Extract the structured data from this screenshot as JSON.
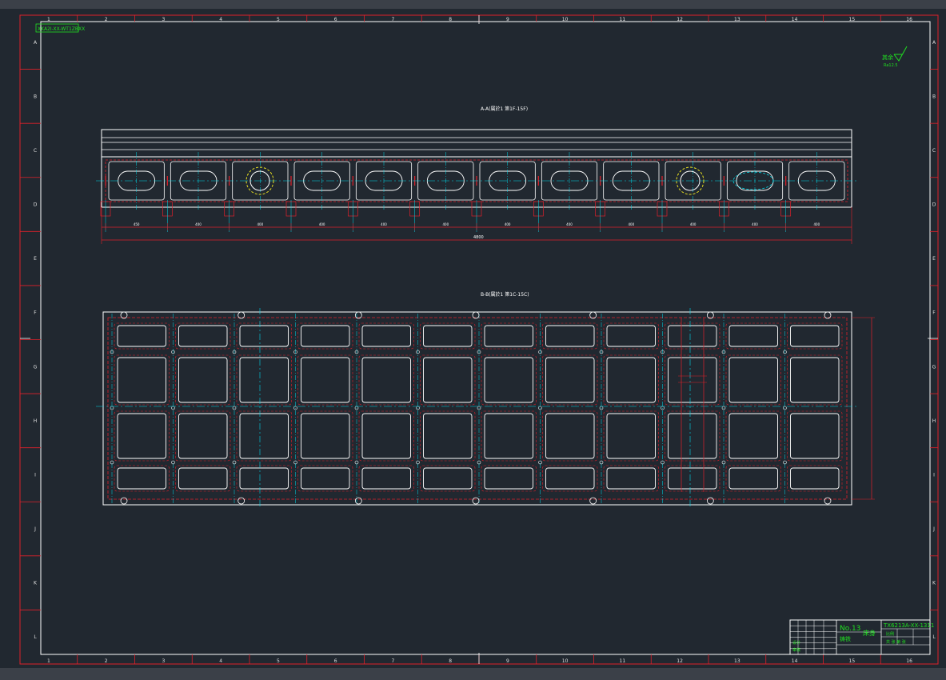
{
  "drawing": {
    "drawing_code_stamp": "XKA2I-XX-WT1ZBXX",
    "section_a_title": "A-A(属於1 第1F-15F)",
    "section_b_title": "B-B(属於1 第1C-15C)",
    "roughness_note_label": "其余",
    "roughness_note_sub": "Ra12.5",
    "col_numbers": [
      "1",
      "2",
      "3",
      "4",
      "5",
      "6",
      "7",
      "8",
      "9",
      "10",
      "11",
      "12",
      "13",
      "14",
      "15",
      "16"
    ],
    "row_letters": [
      "A",
      "B",
      "C",
      "D",
      "E",
      "F",
      "G",
      "H",
      "I",
      "J",
      "K",
      "L"
    ],
    "overall_length_dim": "4800",
    "segment_dims": [
      "450",
      "400",
      "400",
      "400",
      "400",
      "400",
      "400",
      "400",
      "400",
      "400",
      "400",
      "400"
    ]
  },
  "title_block": {
    "number": "No.13",
    "part_name": "床身",
    "material": "铸铁",
    "drawing_no": "TX6213A-XX-1311",
    "scale_label": "比例",
    "sheet_label": "共 张 第 张",
    "designer_label": "设计",
    "checker_label": "审核"
  },
  "colors": {
    "background": "#212830",
    "frame_red": "#e0202a",
    "outline_white": "#ffffff",
    "centerline_cyan": "#00d8e8",
    "text_green": "#20e020",
    "highlight_yellow": "#e8e020"
  }
}
